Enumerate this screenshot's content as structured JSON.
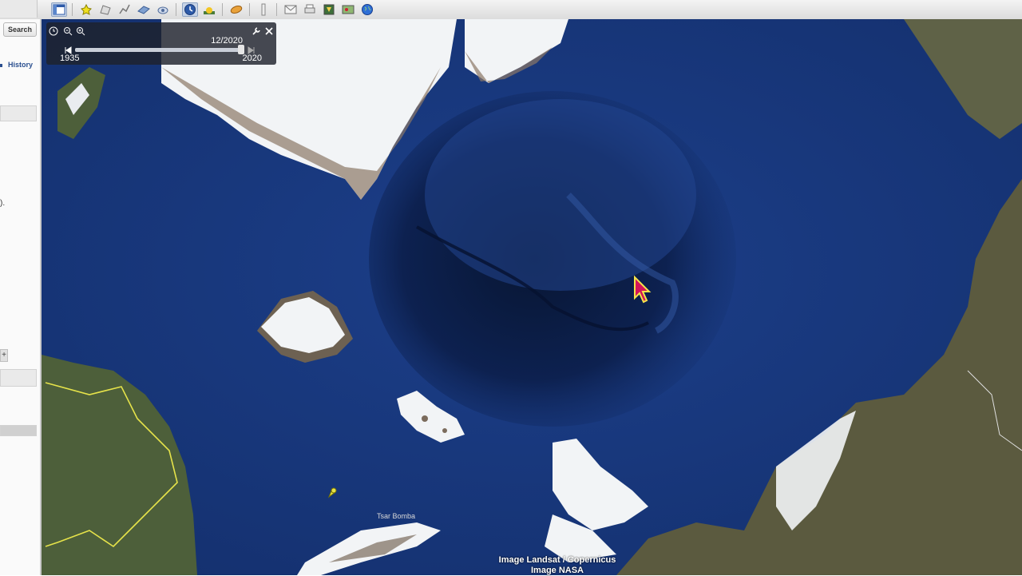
{
  "toolbar": {
    "buttons": [
      {
        "name": "sidebar-toggle",
        "icon": "sidebar-icon"
      },
      {
        "name": "add-placemark",
        "icon": "pushpin-icon"
      },
      {
        "name": "add-polygon",
        "icon": "polygon-icon"
      },
      {
        "name": "add-path",
        "icon": "path-icon"
      },
      {
        "name": "add-overlay",
        "icon": "overlay-icon"
      },
      {
        "name": "record-tour",
        "icon": "tour-icon"
      },
      {
        "name": "historical-imagery",
        "icon": "clock-icon",
        "active": true
      },
      {
        "name": "sunlight",
        "icon": "sun-icon"
      },
      {
        "name": "planets",
        "icon": "planet-icon"
      },
      {
        "name": "ruler",
        "icon": "ruler-icon"
      },
      {
        "name": "email",
        "icon": "email-icon"
      },
      {
        "name": "print",
        "icon": "print-icon"
      },
      {
        "name": "save-image",
        "icon": "image-icon"
      },
      {
        "name": "view-in-maps",
        "icon": "maps-icon"
      },
      {
        "name": "earth",
        "icon": "globe-icon"
      }
    ]
  },
  "sidebar": {
    "search_label": "Search",
    "history_label": "History",
    "truncated_text": ")."
  },
  "time_slider": {
    "current_date": "12/2020",
    "start_year": "1935",
    "end_year": "2020",
    "position": 1.0
  },
  "map": {
    "placemark_label": "Tsar Bomba",
    "attribution_line1": "Image Landsat / Copernicus",
    "attribution_line2": "Image NASA"
  },
  "colors": {
    "ocean": "#16357a",
    "deep_ocean": "#0c1f4d",
    "land": "#4d5f3a",
    "ice": "#f2f4f6",
    "border": "#e6e34a",
    "cursor": "#d4145a"
  }
}
